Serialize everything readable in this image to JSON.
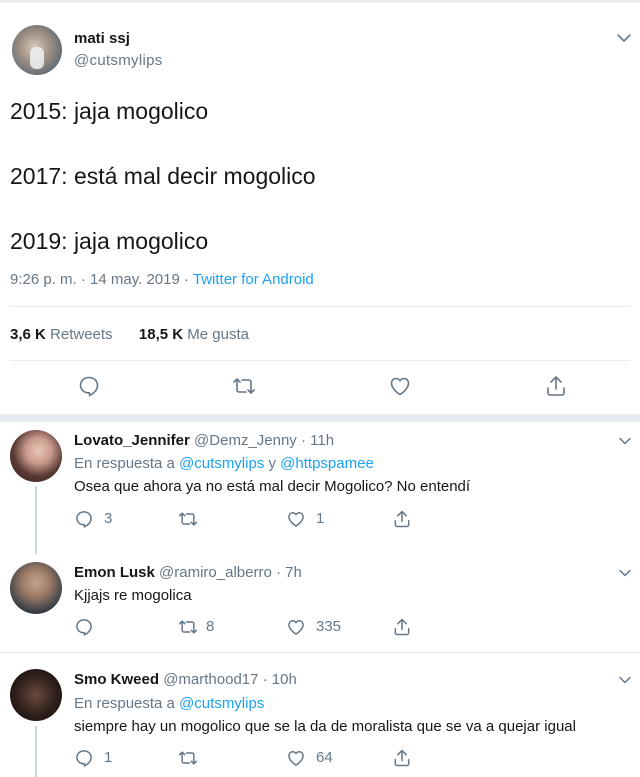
{
  "main_tweet": {
    "name": "mati ssj",
    "handle": "@cutsmylips",
    "text": "2015: jaja mogolico\n\n2017: está mal decir mogolico\n\n2019: jaja mogolico",
    "time": "9:26 p. m. · 14 may. 2019 · ",
    "source": "Twitter for Android",
    "retweets_count": "3,6 K",
    "retweets_label": " Retweets",
    "likes_count": "18,5 K",
    "likes_label": " Me gusta"
  },
  "replies": [
    {
      "name": "Lovato_Jennifer",
      "handle": " @Demz_Jenny · 11h",
      "reply_prefix": "En respuesta a ",
      "mention1": "@cutsmylips",
      "reply_and": " y ",
      "mention2": "@httpspamee",
      "text": "Osea que ahora ya no está mal decir Mogolico? No entendí",
      "replies": "3",
      "retweets": "",
      "likes": "1"
    },
    {
      "name": "Emon Lusk",
      "handle": " @ramiro_alberro · 7h",
      "text": "Kjjajs re mogolica",
      "replies": "",
      "retweets": "8",
      "likes": "335"
    },
    {
      "name": "Smo Kweed",
      "handle": " @marthood17 · 10h",
      "reply_prefix": "En respuesta a ",
      "mention1": "@cutsmylips",
      "text": "siempre hay un mogolico que se la da de moralista que se va a quejar igual",
      "replies": "1",
      "retweets": "",
      "likes": "64"
    }
  ],
  "icons": {
    "reply": "speech-bubble-icon",
    "retweet": "retweet-arrows-icon",
    "like": "heart-icon",
    "share": "share-upload-icon",
    "more": "chevron-down-icon"
  },
  "colors": {
    "accent": "#1da1f2",
    "secondary_text": "#657786",
    "icon": "#657786",
    "divider": "#e6ecf0"
  }
}
